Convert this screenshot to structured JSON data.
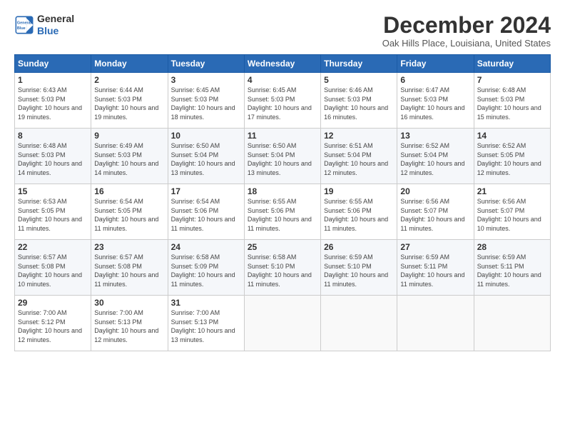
{
  "header": {
    "logo_general": "General",
    "logo_blue": "Blue",
    "month_title": "December 2024",
    "location": "Oak Hills Place, Louisiana, United States"
  },
  "days_of_week": [
    "Sunday",
    "Monday",
    "Tuesday",
    "Wednesday",
    "Thursday",
    "Friday",
    "Saturday"
  ],
  "weeks": [
    [
      {
        "day": "1",
        "sunrise": "6:43 AM",
        "sunset": "5:03 PM",
        "daylight": "10 hours and 19 minutes."
      },
      {
        "day": "2",
        "sunrise": "6:44 AM",
        "sunset": "5:03 PM",
        "daylight": "10 hours and 19 minutes."
      },
      {
        "day": "3",
        "sunrise": "6:45 AM",
        "sunset": "5:03 PM",
        "daylight": "10 hours and 18 minutes."
      },
      {
        "day": "4",
        "sunrise": "6:45 AM",
        "sunset": "5:03 PM",
        "daylight": "10 hours and 17 minutes."
      },
      {
        "day": "5",
        "sunrise": "6:46 AM",
        "sunset": "5:03 PM",
        "daylight": "10 hours and 16 minutes."
      },
      {
        "day": "6",
        "sunrise": "6:47 AM",
        "sunset": "5:03 PM",
        "daylight": "10 hours and 16 minutes."
      },
      {
        "day": "7",
        "sunrise": "6:48 AM",
        "sunset": "5:03 PM",
        "daylight": "10 hours and 15 minutes."
      }
    ],
    [
      {
        "day": "8",
        "sunrise": "6:48 AM",
        "sunset": "5:03 PM",
        "daylight": "10 hours and 14 minutes."
      },
      {
        "day": "9",
        "sunrise": "6:49 AM",
        "sunset": "5:03 PM",
        "daylight": "10 hours and 14 minutes."
      },
      {
        "day": "10",
        "sunrise": "6:50 AM",
        "sunset": "5:04 PM",
        "daylight": "10 hours and 13 minutes."
      },
      {
        "day": "11",
        "sunrise": "6:50 AM",
        "sunset": "5:04 PM",
        "daylight": "10 hours and 13 minutes."
      },
      {
        "day": "12",
        "sunrise": "6:51 AM",
        "sunset": "5:04 PM",
        "daylight": "10 hours and 12 minutes."
      },
      {
        "day": "13",
        "sunrise": "6:52 AM",
        "sunset": "5:04 PM",
        "daylight": "10 hours and 12 minutes."
      },
      {
        "day": "14",
        "sunrise": "6:52 AM",
        "sunset": "5:05 PM",
        "daylight": "10 hours and 12 minutes."
      }
    ],
    [
      {
        "day": "15",
        "sunrise": "6:53 AM",
        "sunset": "5:05 PM",
        "daylight": "10 hours and 11 minutes."
      },
      {
        "day": "16",
        "sunrise": "6:54 AM",
        "sunset": "5:05 PM",
        "daylight": "10 hours and 11 minutes."
      },
      {
        "day": "17",
        "sunrise": "6:54 AM",
        "sunset": "5:06 PM",
        "daylight": "10 hours and 11 minutes."
      },
      {
        "day": "18",
        "sunrise": "6:55 AM",
        "sunset": "5:06 PM",
        "daylight": "10 hours and 11 minutes."
      },
      {
        "day": "19",
        "sunrise": "6:55 AM",
        "sunset": "5:06 PM",
        "daylight": "10 hours and 11 minutes."
      },
      {
        "day": "20",
        "sunrise": "6:56 AM",
        "sunset": "5:07 PM",
        "daylight": "10 hours and 11 minutes."
      },
      {
        "day": "21",
        "sunrise": "6:56 AM",
        "sunset": "5:07 PM",
        "daylight": "10 hours and 10 minutes."
      }
    ],
    [
      {
        "day": "22",
        "sunrise": "6:57 AM",
        "sunset": "5:08 PM",
        "daylight": "10 hours and 10 minutes."
      },
      {
        "day": "23",
        "sunrise": "6:57 AM",
        "sunset": "5:08 PM",
        "daylight": "10 hours and 11 minutes."
      },
      {
        "day": "24",
        "sunrise": "6:58 AM",
        "sunset": "5:09 PM",
        "daylight": "10 hours and 11 minutes."
      },
      {
        "day": "25",
        "sunrise": "6:58 AM",
        "sunset": "5:10 PM",
        "daylight": "10 hours and 11 minutes."
      },
      {
        "day": "26",
        "sunrise": "6:59 AM",
        "sunset": "5:10 PM",
        "daylight": "10 hours and 11 minutes."
      },
      {
        "day": "27",
        "sunrise": "6:59 AM",
        "sunset": "5:11 PM",
        "daylight": "10 hours and 11 minutes."
      },
      {
        "day": "28",
        "sunrise": "6:59 AM",
        "sunset": "5:11 PM",
        "daylight": "10 hours and 11 minutes."
      }
    ],
    [
      {
        "day": "29",
        "sunrise": "7:00 AM",
        "sunset": "5:12 PM",
        "daylight": "10 hours and 12 minutes."
      },
      {
        "day": "30",
        "sunrise": "7:00 AM",
        "sunset": "5:13 PM",
        "daylight": "10 hours and 12 minutes."
      },
      {
        "day": "31",
        "sunrise": "7:00 AM",
        "sunset": "5:13 PM",
        "daylight": "10 hours and 13 minutes."
      },
      null,
      null,
      null,
      null
    ]
  ]
}
